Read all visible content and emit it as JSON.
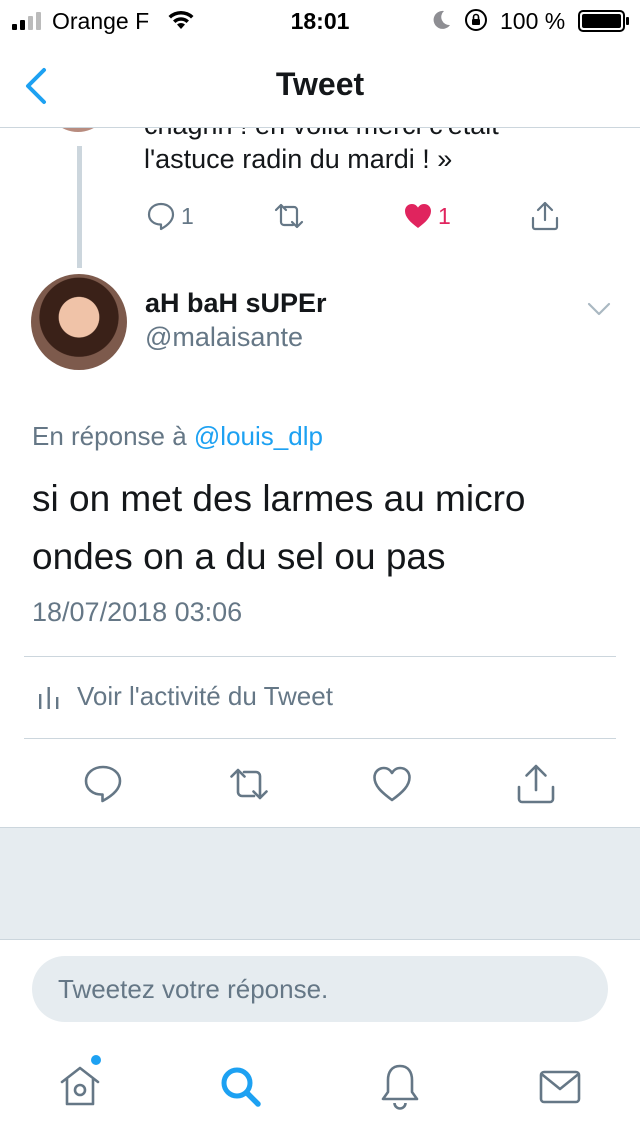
{
  "status_bar": {
    "carrier": "Orange F",
    "time": "18:01",
    "battery_percent": "100 %"
  },
  "nav": {
    "title": "Tweet",
    "back_icon": "chevron-left-icon"
  },
  "parent_tweet": {
    "text_cut": "chagrin ! en voilà merci c'était",
    "text": "l'astuce radin du mardi ! »",
    "reply_count": "1",
    "like_count": "1",
    "liked": true
  },
  "tweet": {
    "display_name": "aH baH sUPEr",
    "username": "@malaisante",
    "reply_prefix": "En réponse à",
    "reply_handle": "@louis_dlp",
    "text": "si on met des larmes au micro ondes on a du sel ou pas",
    "timestamp": "18/07/2018 03:06",
    "activity_label": "Voir l'activité du Tweet"
  },
  "composer": {
    "placeholder": "Tweetez votre réponse."
  },
  "tabs": [
    "home-icon",
    "search-icon",
    "bell-icon",
    "mail-icon"
  ],
  "colors": {
    "accent": "#1da1f2",
    "like": "#e0245e",
    "secondary_text": "#657786",
    "divider": "#ccd6dd",
    "gray_area": "#e6ecf0"
  }
}
